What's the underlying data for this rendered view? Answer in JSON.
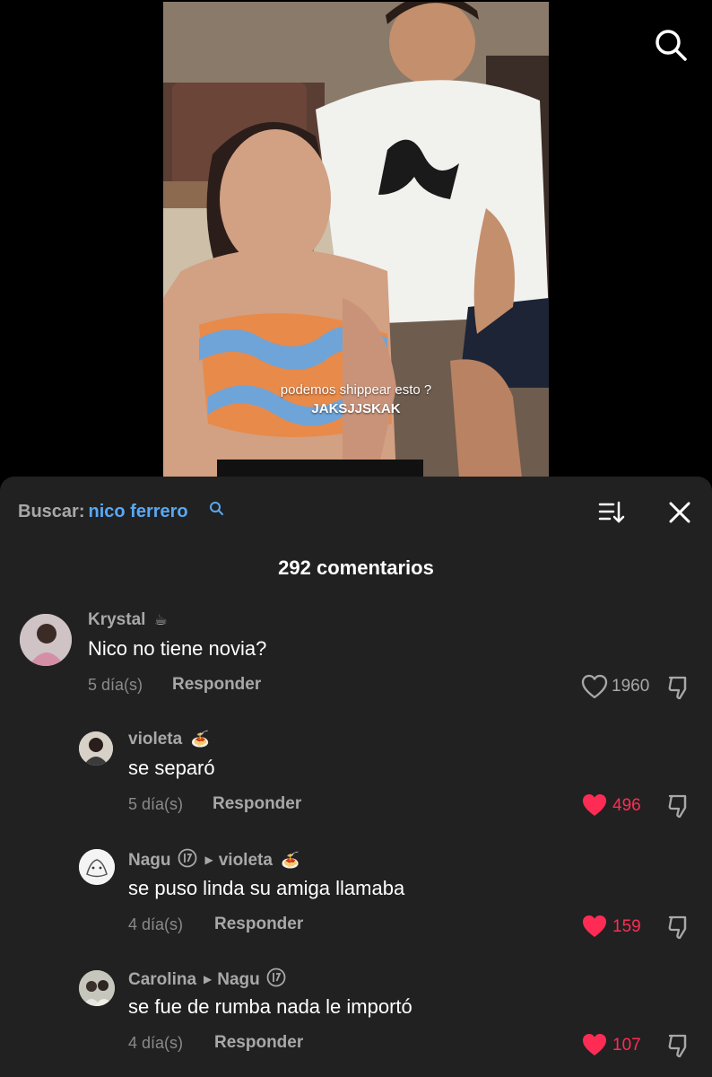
{
  "video": {
    "caption_line1": "podemos shippear esto ?",
    "caption_line2": "JAKSJJSKAK"
  },
  "search": {
    "label": "Buscar:",
    "query": "nico ferrero"
  },
  "comments_count": "292 comentarios",
  "comments": [
    {
      "username": "Krystal",
      "emoji": "☕",
      "text": "Nico no tiene novia?",
      "date": "5 día(s)",
      "reply_label": "Responder",
      "likes": "1960",
      "liked": false
    },
    {
      "username": "violeta",
      "emoji": "🍝",
      "text": "se separó",
      "date": "5 día(s)",
      "reply_label": "Responder",
      "likes": "496",
      "liked": true
    },
    {
      "username": "Nagu",
      "reply_to": "violeta",
      "reply_to_emoji": "🍝",
      "text": "se puso linda su amiga llamaba",
      "date": "4 día(s)",
      "reply_label": "Responder",
      "likes": "159",
      "liked": true
    },
    {
      "username": "Carolina",
      "reply_to": "Nagu",
      "text": "se fue de rumba nada le importó",
      "date": "4 día(s)",
      "reply_label": "Responder",
      "likes": "107",
      "liked": true
    }
  ],
  "colors": {
    "sheet_bg": "#212121",
    "accent_blue": "#59a8f5",
    "like_red": "#fe2c55",
    "muted": "#a8a8a8"
  }
}
